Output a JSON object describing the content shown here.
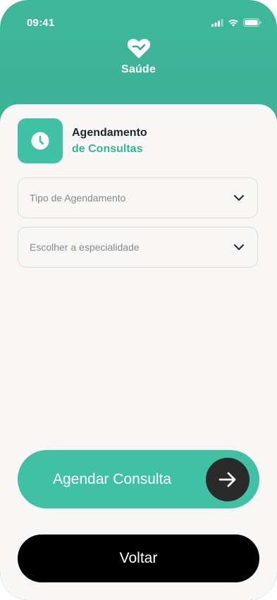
{
  "status_bar": {
    "time": "09:41"
  },
  "header": {
    "brand": "Saúde",
    "logo_icon": "heart-icon"
  },
  "page": {
    "title_line1": "Agendamento",
    "title_line2": "de Consultas",
    "title_icon": "clock-icon"
  },
  "form": {
    "appointment_type": {
      "placeholder": "Tipo de Agendamento",
      "icon": "chevron-down-icon"
    },
    "specialty": {
      "placeholder": "Escolher a especialidade",
      "icon": "chevron-down-icon"
    }
  },
  "actions": {
    "schedule_label": "Agendar Consulta",
    "schedule_icon": "arrow-right-icon",
    "back_label": "Voltar"
  },
  "colors": {
    "accent": "#40c0a5",
    "accent_text": "#34b596",
    "dark": "#2a2a2a",
    "background": "#f8f7f6"
  }
}
